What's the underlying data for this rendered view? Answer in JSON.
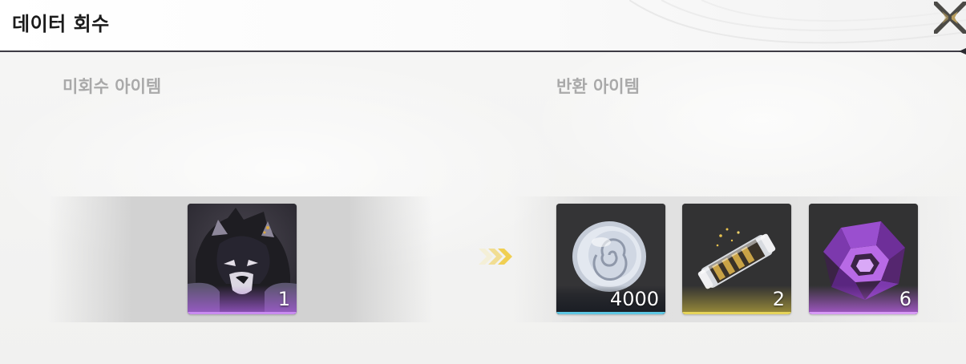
{
  "header": {
    "title": "데이터 회수"
  },
  "sections": {
    "unrecovered_label": "미회수 아이템",
    "returned_label": "반환 아이템"
  },
  "unrecovered_items": [
    {
      "name": "black-wolf-character-portrait",
      "quantity": "1",
      "rarity_color": "#a35bd6"
    }
  ],
  "returned_items": [
    {
      "name": "silver-spiral-coin-icon",
      "quantity": "4000",
      "rarity_color": "#5fc7e3"
    },
    {
      "name": "gold-cylinder-capsule-icon",
      "quantity": "2",
      "rarity_color": "#e6d45a"
    },
    {
      "name": "purple-crystal-polyhedron-icon",
      "quantity": "6",
      "rarity_color": "#b65ee0"
    }
  ],
  "icons": {
    "close": "close-x-icon",
    "arrow": "triple-chevron-right-icon"
  },
  "colors": {
    "accent_gold": "#f0d060",
    "divider": "#3e3c45",
    "title": "#1b1b1b",
    "label": "#a9a9a9"
  }
}
